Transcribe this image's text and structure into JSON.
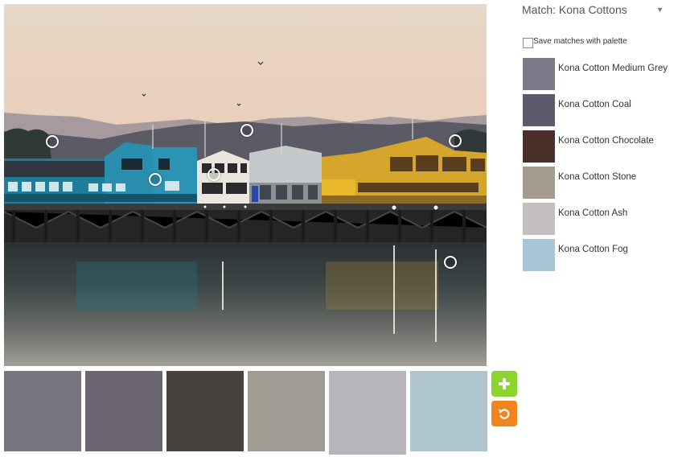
{
  "matches": {
    "header": "Match: Kona Cottons",
    "save_label": "Save matches with palette",
    "items": [
      {
        "name": "Kona Cotton Medium Grey",
        "color": "#7b7a88"
      },
      {
        "name": "Kona Cotton Coal",
        "color": "#5c5a6c"
      },
      {
        "name": "Kona Cotton Chocolate",
        "color": "#4a3028"
      },
      {
        "name": "Kona Cotton Stone",
        "color": "#a59b8c"
      },
      {
        "name": "Kona Cotton Ash",
        "color": "#c3bfc0"
      },
      {
        "name": "Kona Cotton Fog",
        "color": "#a7c5d6"
      }
    ]
  },
  "palette": [
    {
      "color": "#78747f"
    },
    {
      "color": "#6a6570"
    },
    {
      "color": "#46423e"
    },
    {
      "color": "#a19c91"
    },
    {
      "color": "#b8b6bc"
    },
    {
      "color": "#afc5cc"
    }
  ],
  "buttons": {
    "add_icon": "plus-icon",
    "add_color": "#8cd42e",
    "reset_icon": "undo-icon",
    "reset_color": "#f0841d"
  }
}
